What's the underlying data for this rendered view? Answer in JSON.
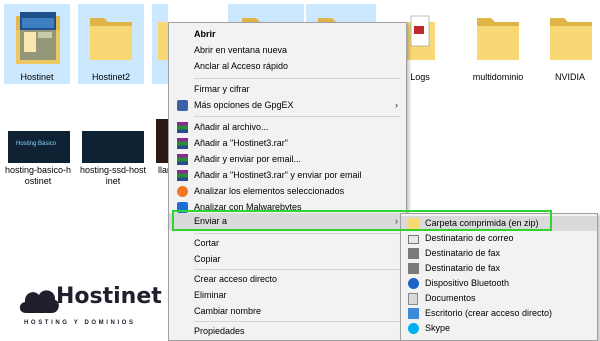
{
  "desktop": {
    "items_row1": [
      {
        "label": "Hostinet",
        "selected": true
      },
      {
        "label": "Hostinet2",
        "selected": true
      },
      {
        "label": "",
        "selected": true
      },
      {
        "label": "",
        "selected": true
      },
      {
        "label": "",
        "selected": true
      },
      {
        "label": "Logs",
        "selected": false
      },
      {
        "label": "multidominio",
        "selected": false
      },
      {
        "label": "NVIDIA",
        "selected": false
      }
    ],
    "items_row2": [
      {
        "label_line1": "hosting-basico-h",
        "label_line2": "ostinet"
      },
      {
        "label_line1": "hosting-ssd-host",
        "label_line2": "inet"
      },
      {
        "label_line1": "llar",
        "label_line2": ""
      }
    ],
    "thumb_text": "Hosting Básico"
  },
  "context_menu": {
    "items": [
      {
        "label": "Abrir",
        "bold": true
      },
      {
        "label": "Abrir en ventana nueva"
      },
      {
        "label": "Anclar al Acceso rápido"
      },
      {
        "label": "Firmar y cifrar"
      },
      {
        "label": "Más opciones de GpgEX"
      },
      {
        "label": "Añadir al archivo..."
      },
      {
        "label": "Añadir a \"Hostinet3.rar\""
      },
      {
        "label": "Añadir y enviar por email..."
      },
      {
        "label": "Añadir a \"Hostinet3.rar\" y enviar por email"
      },
      {
        "label": "Analizar los elementos seleccionados"
      },
      {
        "label": "Analizar con Malwarebytes"
      },
      {
        "label": "Enviar a"
      },
      {
        "label": "Cortar"
      },
      {
        "label": "Copiar"
      },
      {
        "label": "Crear acceso directo"
      },
      {
        "label": "Eliminar"
      },
      {
        "label": "Cambiar nombre"
      },
      {
        "label": "Propiedades"
      }
    ],
    "submenu_arrow": "›"
  },
  "send_to_menu": {
    "items": [
      {
        "label": "Carpeta comprimida (en zip)"
      },
      {
        "label": "Destinatario de correo"
      },
      {
        "label": "Destinatario de fax"
      },
      {
        "label": "Destinatario de fax"
      },
      {
        "label": "Dispositivo Bluetooth"
      },
      {
        "label": "Documentos"
      },
      {
        "label": "Escritorio (crear acceso directo)"
      },
      {
        "label": "Skype"
      }
    ]
  },
  "logo": {
    "name": "Hostinet",
    "tagline": "HOSTING Y DOMINIOS"
  },
  "colors": {
    "selection": "#cce8ff",
    "highlight_border": "#2fd52f",
    "folder": "#f8d775"
  }
}
